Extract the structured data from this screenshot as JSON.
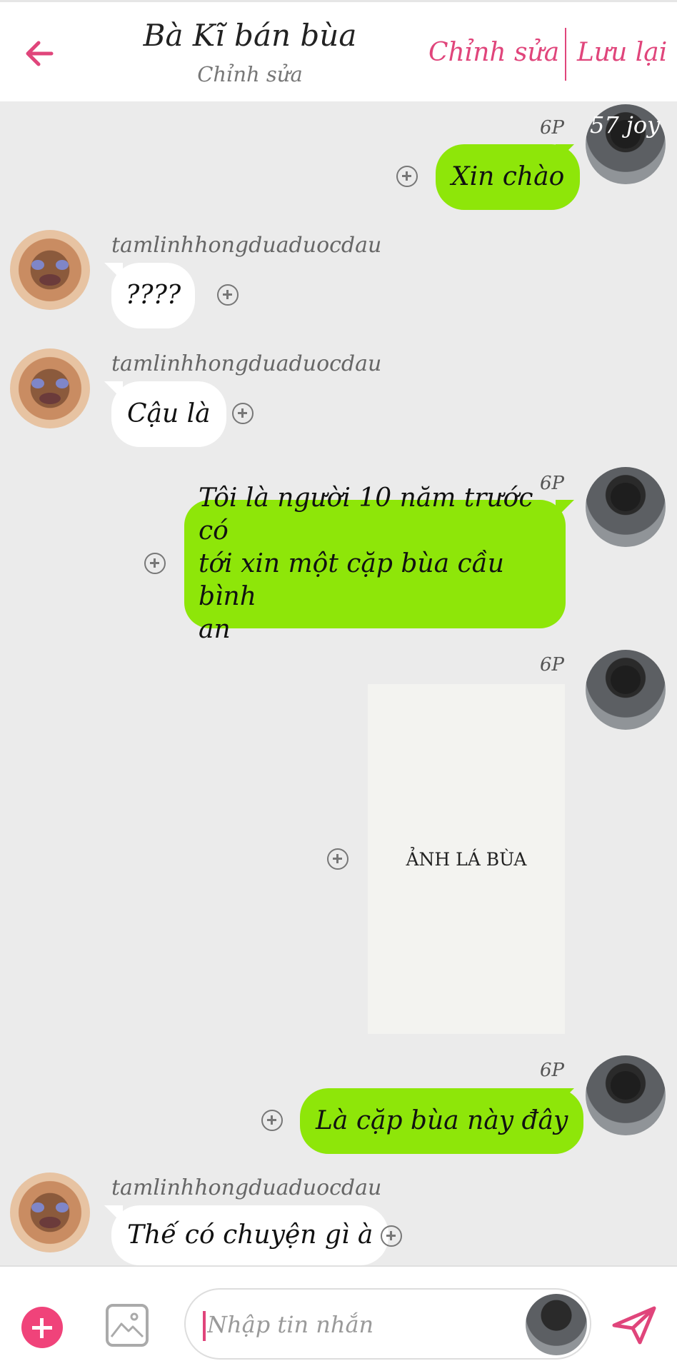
{
  "header": {
    "title": "Bà Kĩ bán bùa",
    "subtitle": "Chỉnh sửa",
    "edit_label": "Chỉnh sửa",
    "save_label": "Lưu lại",
    "back_icon": "arrow-left-icon"
  },
  "colors": {
    "accent": "#e0457b",
    "sent_bubble": "#8ee609",
    "received_bubble": "#ffffff",
    "chat_background": "#ebebeb"
  },
  "messages": [
    {
      "side": "sent",
      "time": "6P",
      "text": "Xin chào",
      "avatar_caption": "57 joy"
    },
    {
      "side": "received",
      "username": "tamlinhhongduaduocdau",
      "text": "????"
    },
    {
      "side": "received",
      "username": "tamlinhhongduaduocdau",
      "text": "Cậu là"
    },
    {
      "side": "sent",
      "time": "6P",
      "text_lines": [
        "Tôi là người 10 năm trước có",
        "tới xin một cặp bùa cầu bình",
        "an"
      ]
    },
    {
      "side": "sent",
      "time": "6P",
      "image_caption": "ẢNH LÁ BÙA"
    },
    {
      "side": "sent",
      "time": "6P",
      "text": "Là cặp bùa này đây"
    },
    {
      "side": "received",
      "username": "tamlinhhongduaduocdau",
      "text": "Thế có chuyện gì à"
    }
  ],
  "composer": {
    "placeholder": "Nhập tin nhắn",
    "add_icon": "plus-circle-icon",
    "image_icon": "image-icon",
    "send_icon": "send-icon"
  }
}
